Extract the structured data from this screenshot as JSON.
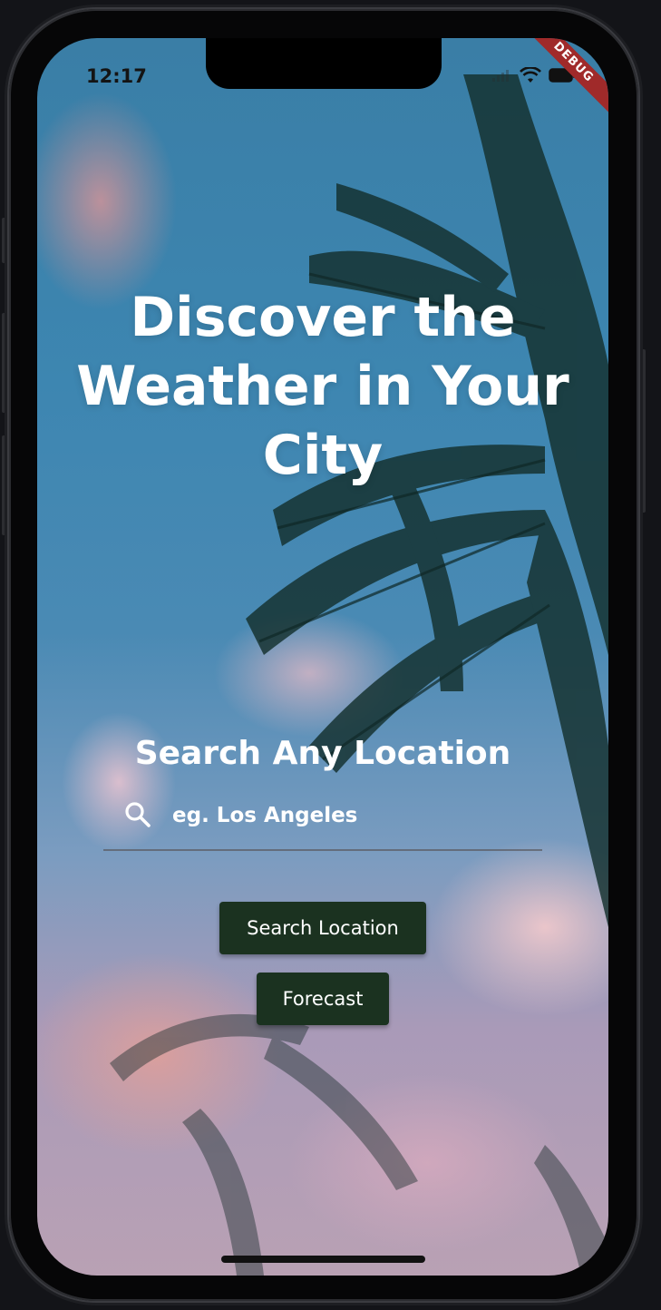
{
  "status_bar": {
    "time": "12:17",
    "debug_label": "DEBUG"
  },
  "hero": {
    "title": "Discover the Weather in Your City"
  },
  "search": {
    "heading": "Search Any Location",
    "placeholder": "eg. Los Angeles",
    "value": ""
  },
  "buttons": {
    "search_label": "Search Location",
    "forecast_label": "Forecast"
  },
  "icons": {
    "search": "search-icon",
    "wifi": "wifi-icon",
    "battery": "battery-icon",
    "signal": "cellular-signal-icon"
  },
  "colors": {
    "button_bg": "#1b3220",
    "text": "#ffffff",
    "debug_ribbon": "#a02a2a"
  }
}
